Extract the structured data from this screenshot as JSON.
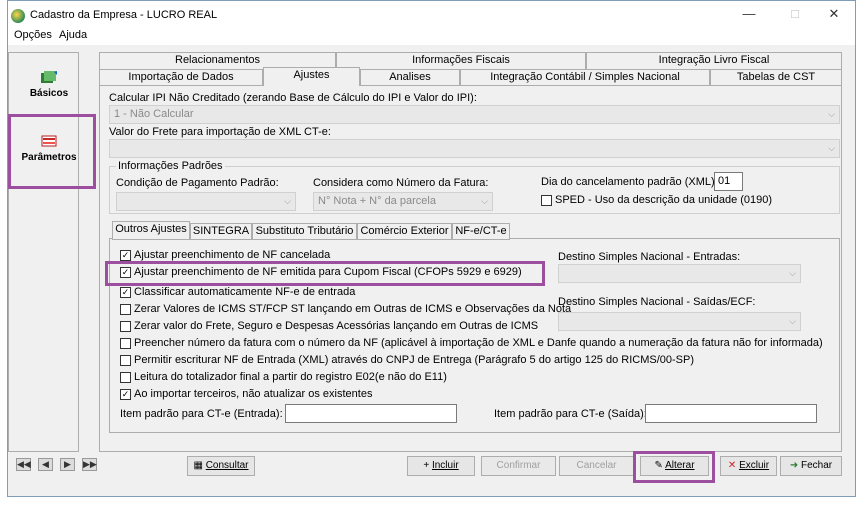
{
  "window": {
    "title": "Cadastro da Empresa - LUCRO REAL"
  },
  "menu": {
    "opcoes": "Opções",
    "ajuda": "Ajuda"
  },
  "nav": {
    "basicos": "Básicos",
    "parametros": "Parâmetros"
  },
  "tabs_row1": [
    "Relacionamentos",
    "Informações Fiscais",
    "Integração Livro Fiscal"
  ],
  "tabs_row2": [
    "Importação de Dados",
    "Ajustes",
    "Analises",
    "Integração Contábil / Simples Nacional",
    "Tabelas de CST"
  ],
  "fields": {
    "ipi_label": "Calcular IPI Não Creditado (zerando Base de Cálculo do IPI e Valor do IPI):",
    "ipi_value": "1 - Não Calcular",
    "frete_label": "Valor do Frete para importação de XML CT-e:",
    "frete_value": ""
  },
  "info_padroes": {
    "title": "Informações Padrões",
    "cond_pag_label": "Condição de Pagamento Padrão:",
    "cond_pag_value": "",
    "num_fatura_label": "Considera como Número da Fatura:",
    "num_fatura_value": "N° Nota + N° da parcela",
    "dia_cancel_label": "Dia do cancelamento padrão (XML):",
    "dia_cancel_value": "01",
    "sped_label": "SPED - Uso da descrição da unidade (0190)"
  },
  "subtabs": [
    "Outros Ajustes",
    "SINTEGRA",
    "Substituto Tributário",
    "Comércio Exterior",
    "NF-e/CT-e"
  ],
  "checks": [
    {
      "label": "Ajustar preenchimento de NF cancelada",
      "checked": true
    },
    {
      "label": "Ajustar preenchimento de NF emitida para Cupom Fiscal (CFOPs 5929 e 6929)",
      "checked": true
    },
    {
      "label": "Classificar automaticamente NF-e de entrada",
      "checked": true
    },
    {
      "label": "Zerar Valores de ICMS ST/FCP ST lançando em Outras de ICMS e Observações da Nota",
      "checked": false
    },
    {
      "label": "Zerar valor do Frete, Seguro e Despesas Acessórias lançando em Outras de ICMS",
      "checked": false
    },
    {
      "label": "Preencher número da fatura com o número da NF (aplicável à importação de XML e Danfe quando a numeração da fatura não for informada)",
      "checked": false
    },
    {
      "label": "Permitir escriturar NF de Entrada (XML) através do CNPJ de Entrega (Parágrafo 5 do artigo 125 do RICMS/00-SP)",
      "checked": false
    },
    {
      "label": "Leitura do totalizador final a partir do registro E02(e não do E11)",
      "checked": false
    },
    {
      "label": "Ao importar terceiros, não atualizar os existentes",
      "checked": true
    }
  ],
  "destino": {
    "entradas_label": "Destino Simples Nacional - Entradas:",
    "saidas_label": "Destino Simples Nacional - Saídas/ECF:"
  },
  "item_cte": {
    "entrada_label": "Item padrão para CT-e (Entrada):",
    "saida_label": "Item padrão para CT-e (Saída):"
  },
  "buttons": {
    "consultar": "Consultar",
    "incluir": "Incluir",
    "confirmar": "Confirmar",
    "cancelar": "Cancelar",
    "alterar": "Alterar",
    "excluir": "Excluir",
    "fechar": "Fechar"
  },
  "colors": {
    "highlight": "#9b4f9e"
  }
}
